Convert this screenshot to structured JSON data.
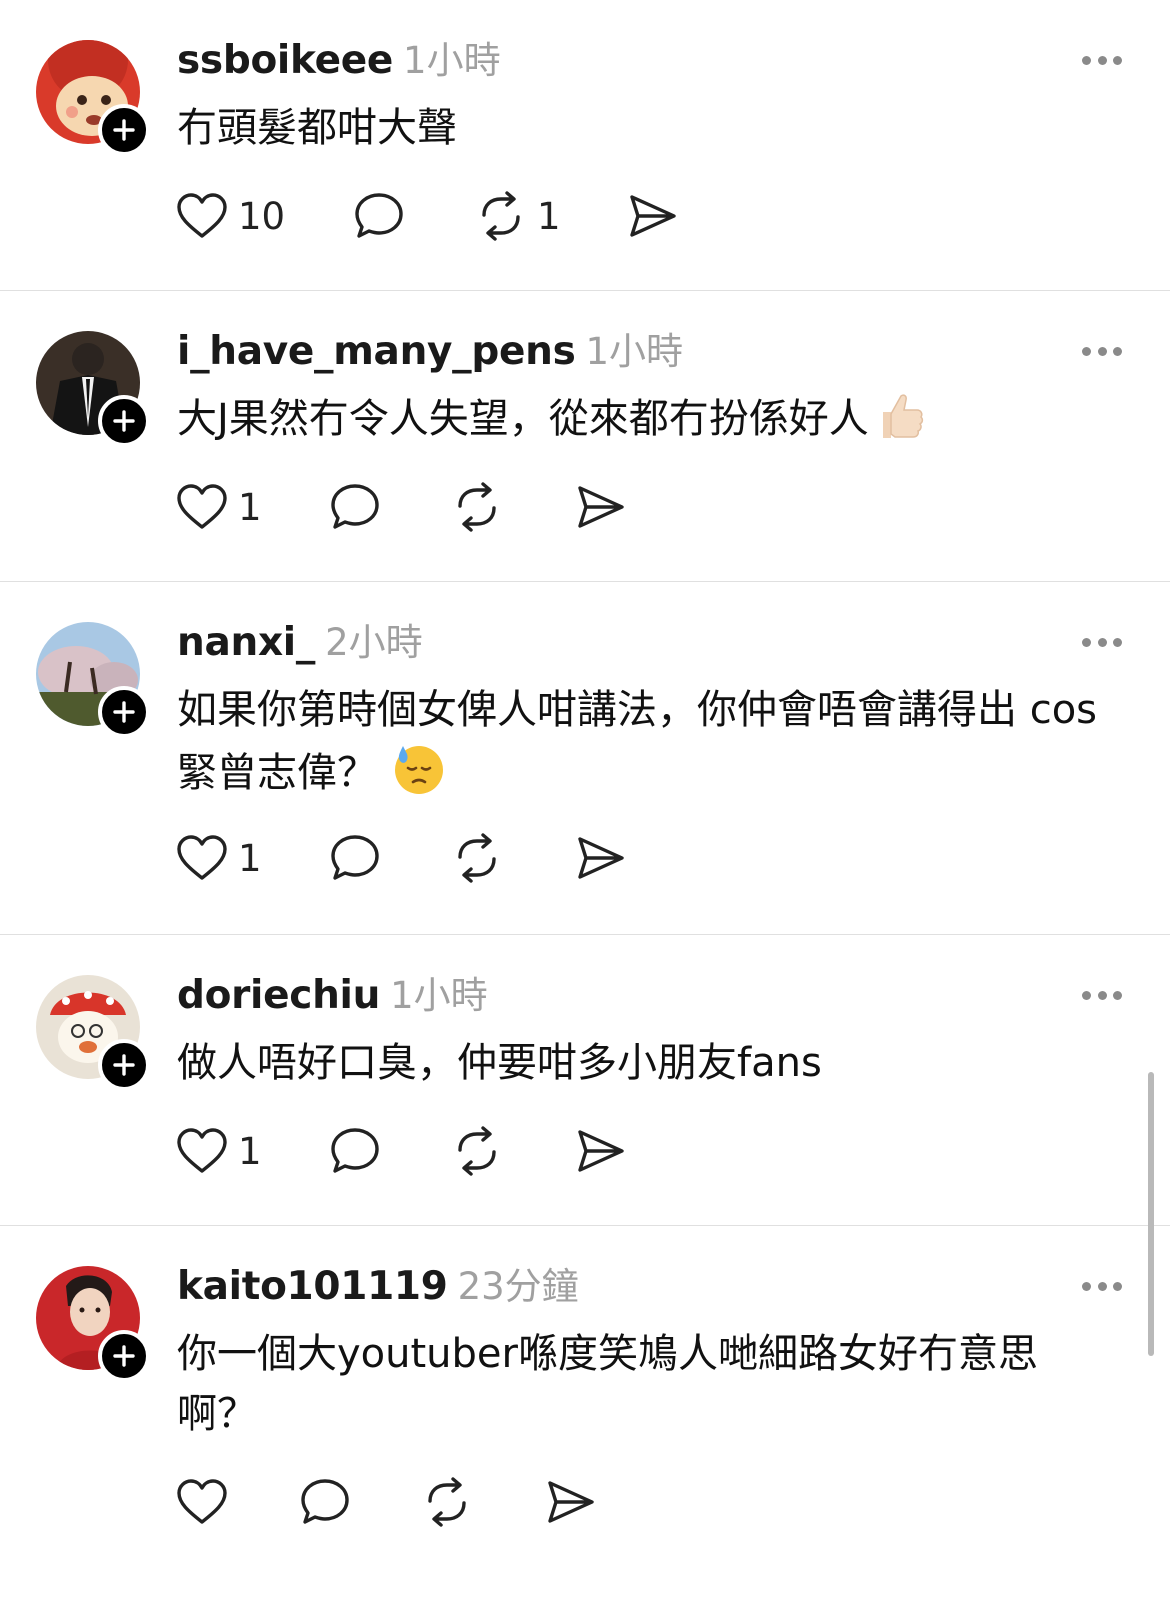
{
  "posts": [
    {
      "username": "ssboikeee",
      "time": "1小時",
      "text": "冇頭髮都咁大聲",
      "likes": "10",
      "reposts": "1",
      "avatar_icon": "cartoon-character-avatar"
    },
    {
      "username": "i_have_many_pens",
      "time": "1小時",
      "text": "大J果然冇令人失望，從來都冇扮係好人",
      "emoji": "thumbs-up-emoji",
      "likes": "1",
      "reposts": "",
      "avatar_icon": "suit-avatar"
    },
    {
      "username": "nanxi_",
      "time": "2小時",
      "text": "如果你第時個女俾人咁講法，你仲會唔會講得出 cos緊曾志偉？",
      "emoji": "downcast-sweat-emoji",
      "likes": "1",
      "reposts": "",
      "avatar_icon": "cherry-blossom-avatar"
    },
    {
      "username": "doriechiu",
      "time": "1小時",
      "text": "做人唔好口臭，仲要咁多小朋友fans",
      "likes": "1",
      "reposts": "",
      "avatar_icon": "illustrated-character-avatar"
    },
    {
      "username": "kaito101119",
      "time": "23分鐘",
      "text": "你一個大youtuber喺度笑鳩人哋細路女好冇意思啊？",
      "likes": "",
      "reposts": "",
      "avatar_icon": "portrait-avatar"
    }
  ]
}
